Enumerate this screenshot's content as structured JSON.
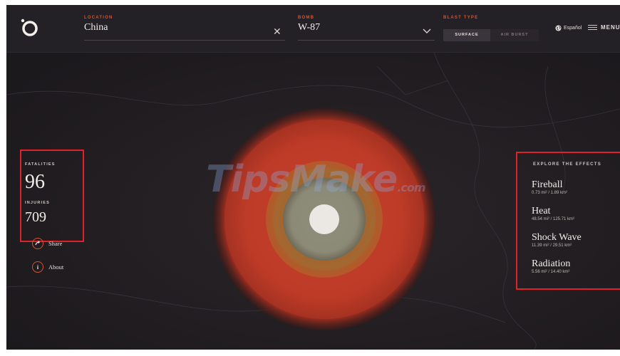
{
  "header": {
    "location": {
      "label": "LOCATION",
      "value": "China"
    },
    "bomb": {
      "label": "BOMB",
      "value": "W-87"
    },
    "blast_type": {
      "label": "BLAST TYPE",
      "options": [
        "SURFACE",
        "AIR BURST"
      ],
      "selected": "SURFACE"
    },
    "language": "Español",
    "menu": "MENU"
  },
  "stats": {
    "fatalities_label": "FATALITIES",
    "fatalities": "96",
    "injuries_label": "INJURIES",
    "injuries": "709"
  },
  "actions": {
    "share": "Share",
    "about": "About"
  },
  "effects": {
    "title": "EXPLORE THE EFFECTS",
    "items": [
      {
        "name": "Fireball",
        "area": "0.73 mi² / 1.89 km²"
      },
      {
        "name": "Heat",
        "area": "48.54 mi² / 125.71 km²"
      },
      {
        "name": "Shock Wave",
        "area": "11.39 mi² / 29.51 km²"
      },
      {
        "name": "Radiation",
        "area": "5.56 mi² / 14.40 km²"
      }
    ]
  },
  "watermark": {
    "main": "TipsMake",
    "suffix": ".com"
  },
  "colors": {
    "accent": "#d9532f",
    "highlight_border": "#e0202a",
    "background": "#1c191d"
  }
}
